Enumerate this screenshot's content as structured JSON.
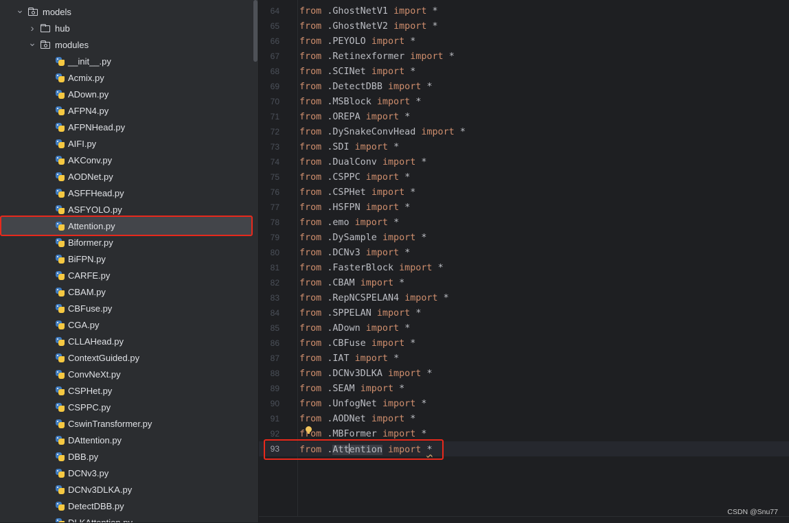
{
  "tree": {
    "folders": [
      {
        "label": "models",
        "chevron": "chevron-down",
        "icon": "folder-module-icon"
      },
      {
        "label": "hub",
        "chevron": "chevron-right",
        "icon": "folder-icon"
      },
      {
        "label": "modules",
        "chevron": "chevron-down",
        "icon": "folder-module-icon"
      }
    ],
    "files": [
      "__init__.py",
      "Acmix.py",
      "ADown.py",
      "AFPN4.py",
      "AFPNHead.py",
      "AIFI.py",
      "AKConv.py",
      "AODNet.py",
      "ASFFHead.py",
      "ASFYOLO.py",
      "Attention.py",
      "Biformer.py",
      "BiFPN.py",
      "CARFE.py",
      "CBAM.py",
      "CBFuse.py",
      "CGA.py",
      "CLLAHead.py",
      "ContextGuided.py",
      "ConvNeXt.py",
      "CSPHet.py",
      "CSPPC.py",
      "CswinTransformer.py",
      "DAttention.py",
      "DBB.py",
      "DCNv3.py",
      "DCNv3DLKA.py",
      "DetectDBB.py",
      "DLKAttention.py"
    ],
    "selected_file": "Attention.py"
  },
  "editor": {
    "keyword_from": "from",
    "keyword_import": "import",
    "star": "*",
    "lines": [
      {
        "num": "64",
        "module": ".GhostNetV1"
      },
      {
        "num": "65",
        "module": ".GhostNetV2"
      },
      {
        "num": "66",
        "module": ".PEYOLO"
      },
      {
        "num": "67",
        "module": ".Retinexformer"
      },
      {
        "num": "68",
        "module": ".SCINet"
      },
      {
        "num": "69",
        "module": ".DetectDBB"
      },
      {
        "num": "70",
        "module": ".MSBlock"
      },
      {
        "num": "71",
        "module": ".OREPA"
      },
      {
        "num": "72",
        "module": ".DySnakeConvHead"
      },
      {
        "num": "73",
        "module": ".SDI"
      },
      {
        "num": "74",
        "module": ".DualConv"
      },
      {
        "num": "75",
        "module": ".CSPPC"
      },
      {
        "num": "76",
        "module": ".CSPHet"
      },
      {
        "num": "77",
        "module": ".HSFPN"
      },
      {
        "num": "78",
        "module": ".emo"
      },
      {
        "num": "79",
        "module": ".DySample"
      },
      {
        "num": "80",
        "module": ".DCNv3"
      },
      {
        "num": "81",
        "module": ".FasterBlock"
      },
      {
        "num": "82",
        "module": ".CBAM"
      },
      {
        "num": "83",
        "module": ".RepNCSPELAN4"
      },
      {
        "num": "84",
        "module": ".SPPELAN"
      },
      {
        "num": "85",
        "module": ".ADown"
      },
      {
        "num": "86",
        "module": ".CBFuse"
      },
      {
        "num": "87",
        "module": ".IAT"
      },
      {
        "num": "88",
        "module": ".DCNv3DLKA"
      },
      {
        "num": "89",
        "module": ".SEAM"
      },
      {
        "num": "90",
        "module": ".UnfogNet"
      },
      {
        "num": "91",
        "module": ".AODNet"
      },
      {
        "num": "92",
        "module": ".MBFormer"
      },
      {
        "num": "93",
        "module": ".Attention"
      }
    ],
    "current_line": "93"
  },
  "watermark": "CSDN @Snu77",
  "colors": {
    "sidebar_bg": "#2b2d30",
    "editor_bg": "#1e1f22",
    "keyword": "#cf8e6d",
    "text": "#bcbec4",
    "annotation_red": "#e8291c"
  }
}
